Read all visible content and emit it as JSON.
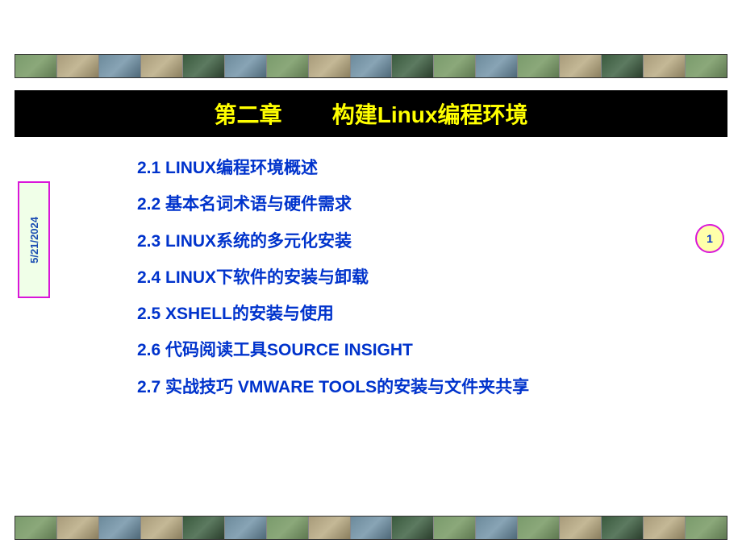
{
  "title": "第二章        构建Linux编程环境",
  "date": "5/21/2024",
  "page_number": "1",
  "toc": [
    "2.1 LINUX编程环境概述",
    "2.2 基本名词术语与硬件需求",
    "2.3  LINUX系统的多元化安装",
    "2.4 LINUX下软件的安装与卸载",
    "2.5 XSHELL的安装与使用",
    "2.6 代码阅读工具SOURCE INSIGHT",
    "2.7 实战技巧 VMWARE TOOLS的安装与文件夹共享"
  ]
}
